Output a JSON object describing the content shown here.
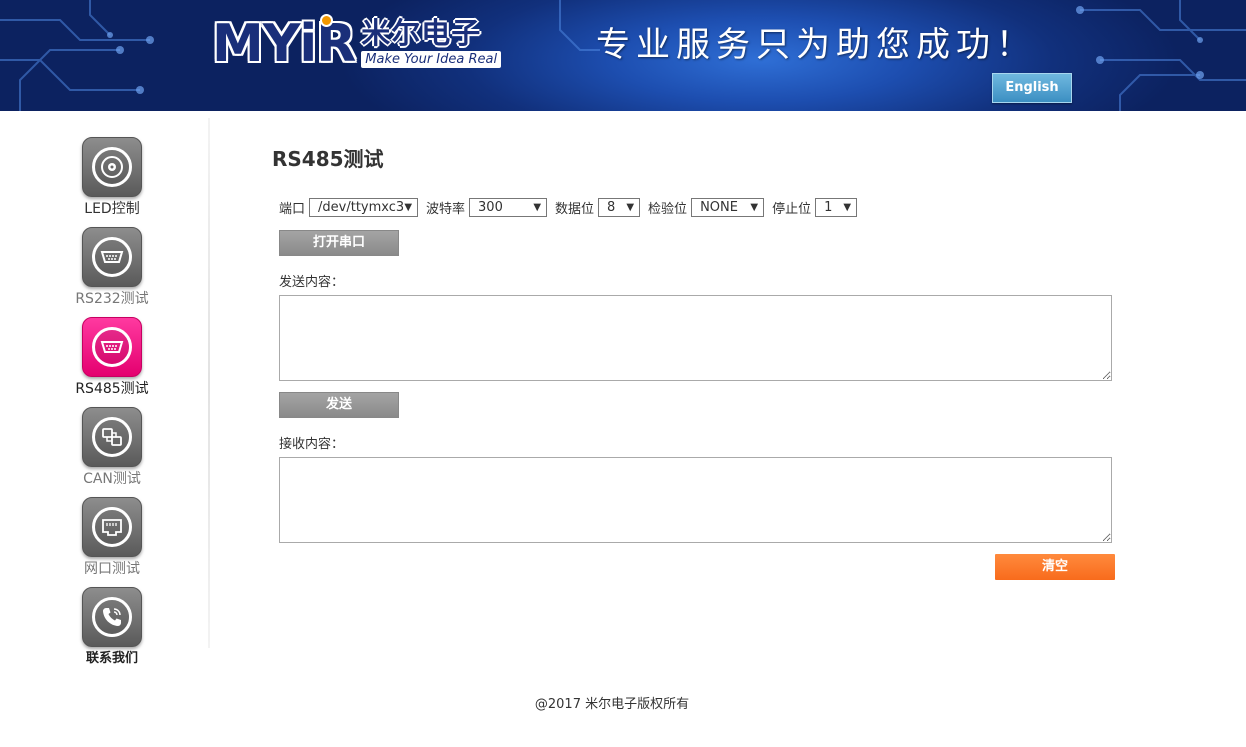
{
  "header": {
    "logo_text": "MYiR",
    "logo_cn": "米尔电子",
    "logo_tagline": "Make Your Idea Real",
    "slogan": "专业服务只为助您成功！",
    "language_button": "English"
  },
  "sidebar": {
    "items": [
      {
        "label": "LED控制",
        "icon": "led-icon"
      },
      {
        "label": "RS232测试",
        "icon": "serial-port-icon"
      },
      {
        "label": "RS485测试",
        "icon": "serial-port-icon",
        "active": true
      },
      {
        "label": "CAN测试",
        "icon": "can-bus-icon"
      },
      {
        "label": "网口测试",
        "icon": "ethernet-icon"
      },
      {
        "label": "联系我们",
        "icon": "phone-icon"
      }
    ]
  },
  "main": {
    "title": "RS485测试",
    "settings": {
      "port_label": "端口",
      "port_value": "/dev/ttymxc3",
      "baud_label": "波特率",
      "baud_value": "300",
      "databits_label": "数据位",
      "databits_value": "8",
      "parity_label": "检验位",
      "parity_value": "NONE",
      "stopbits_label": "停止位",
      "stopbits_value": "1"
    },
    "open_port_button": "打开串口",
    "send_label": "发送内容：",
    "send_value": "",
    "send_button": "发送",
    "receive_label": "接收内容：",
    "receive_value": "",
    "clear_button": "清空"
  },
  "footer": {
    "copyright": "@2017 米尔电子版权所有"
  },
  "colors": {
    "active_nav": "#e4006f",
    "clear_button": "#f86b1c",
    "gray_button": "#999999",
    "banner": "#11307c"
  }
}
